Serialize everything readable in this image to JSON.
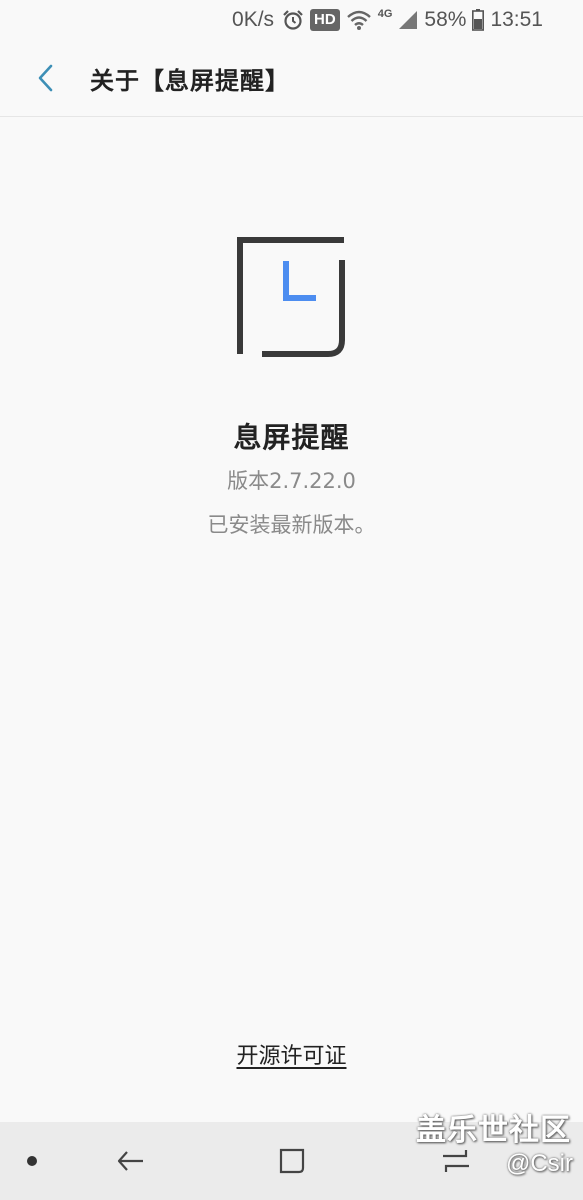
{
  "status_bar": {
    "net_speed": "0K/s",
    "hd_label": "HD",
    "network_type": "4G",
    "battery_percent": "58%",
    "time": "13:51",
    "icons": [
      "alarm-icon",
      "wifi-icon",
      "signal-icon",
      "battery-icon"
    ]
  },
  "header": {
    "title": "关于【息屏提醒】",
    "back_icon": "back-arrow-icon",
    "accent_color": "#3d8fb6"
  },
  "app": {
    "name": "息屏提醒",
    "version": "版本2.7.22.0",
    "status": "已安装最新版本。",
    "logo_accent_color": "#4d8df0",
    "logo_frame_color": "#3a3a3a"
  },
  "footer": {
    "license_link": "开源许可证"
  },
  "nav_bar": {
    "items": [
      "dot-icon",
      "back-icon",
      "home-icon",
      "recents-icon"
    ]
  },
  "watermark": {
    "text": "盖乐世社区",
    "handle": "@Csir"
  }
}
